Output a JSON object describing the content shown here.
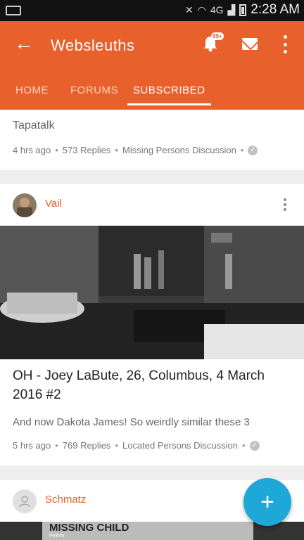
{
  "status_bar": {
    "network": "4G",
    "time": "2:28 AM"
  },
  "app_bar": {
    "title": "Websleuths",
    "notification_badge": "99+",
    "icons": [
      "back-arrow-icon",
      "bell-icon",
      "mail-icon",
      "more-vert-icon"
    ],
    "accent": "#e8602c"
  },
  "tabs": [
    {
      "label": "HOME",
      "active": false
    },
    {
      "label": "FORUMS",
      "active": false
    },
    {
      "label": "SUBSCRIBED",
      "active": true
    }
  ],
  "posts": [
    {
      "excerpt": "Tapatalk",
      "time": "4 hrs ago",
      "replies": "573 Replies",
      "forum": "Missing Persons Discussion"
    },
    {
      "author": "Vail",
      "title": "OH - Joey LaBute, 26, Columbus, 4 March 2016 #2",
      "excerpt": "And now Dakota James! So weirdly similar these 3",
      "time": "5 hrs ago",
      "replies": "769 Replies",
      "forum": "Located Persons Discussion"
    },
    {
      "author": "Schmatz",
      "image_text": "MISSING CHILD",
      "image_subtext": "PEKIN"
    }
  ],
  "fab": {
    "label": "+",
    "color": "#1ea8d8"
  }
}
